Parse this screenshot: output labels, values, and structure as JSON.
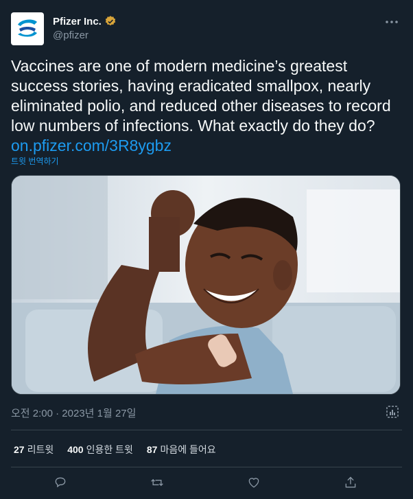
{
  "author": {
    "name": "Pfizer Inc.",
    "handle": "@pfizer",
    "avatar_icon": "pfizer-logo-icon",
    "verified_icon": "verified-badge-icon",
    "verified_color": "#d9a53a"
  },
  "tweet": {
    "text": "Vaccines are one of modern medicine’s greatest success stories, having eradicated smallpox, nearly eliminated polio, and reduced other diseases to record low numbers of infections. What exactly do they do? ",
    "link_text": "on.pfizer.com/3R8ygbz",
    "translate_label": "트윗 번역하기",
    "media_description_icon": "photo-child-flexing-with-bandage"
  },
  "meta": {
    "timestamp": "오전 2:00 · 2023년 1월 27일"
  },
  "stats": {
    "retweets_count": "27",
    "retweets_label": "리트윗",
    "quotes_count": "400",
    "quotes_label": "인용한 트윗",
    "likes_count": "87",
    "likes_label": "마음에 들어요"
  },
  "actions": {
    "reply_icon": "reply-icon",
    "retweet_icon": "retweet-icon",
    "like_icon": "heart-icon",
    "share_icon": "share-icon"
  },
  "colors": {
    "background": "#15202b",
    "accent": "#1d9bf0",
    "muted": "#8b98a5",
    "border": "#38444d"
  }
}
